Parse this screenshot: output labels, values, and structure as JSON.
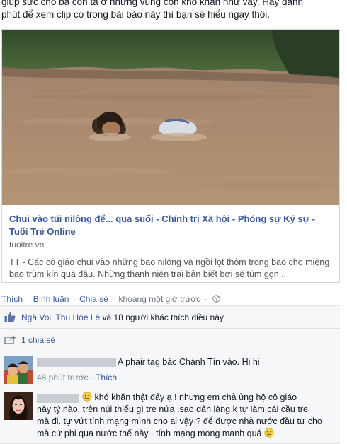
{
  "post": {
    "text_line1": "giúp sức cho bà con ta ở những vùng còn khó khăn như vậy. Hãy dành",
    "text_line2": "phút để xem clip có trong bài báo này thì bạn sẽ hiểu ngay thôi."
  },
  "link_card": {
    "title": "Chui vào túi nilông để... qua suối - Chính trị Xã hội - Phóng sự Ký sự - Tuổi Trẻ Online",
    "domain": "tuoitre.vn",
    "description": "TT - Các cô giáo chui vào những bao nilông và ngồi lọt thỏm trong bao cho miệng bao trùm kín quá đầu. Những thanh niên trai bản biết bơi sẽ túm gọn..."
  },
  "actions": {
    "like": "Thích",
    "comment": "Bình luận",
    "share": "Chia sẻ",
    "time": "khoảng một giờ trước",
    "separator": "·"
  },
  "likes": {
    "names": "Ngà Voi, Thu Hòe Lê",
    "rest": " và 18 người khác thích điều này."
  },
  "shares": {
    "text": "1 chia sẻ"
  },
  "comments": [
    {
      "text": "A phair tag bác Chánh Tín vào. Hi hi",
      "time": "48 phút trước",
      "like": "Thích",
      "separator": "·"
    },
    {
      "emoticon": "smile-emoticon",
      "line1": " khó khăn thật đấy ạ ! nhưng em chả ủng hộ cô giáo",
      "line2": "này tý nào. trên núi thiếu gì tre nứa .sao dân làng k tự làm cái cầu tre",
      "line3": "mà đi. tự vứt tính mạng mình cho ai vậy ? để được nhà nước đầu tư cho",
      "line4": "mà cứ phi qua nước thế này . tính mạng mong manh quá"
    }
  ],
  "colors": {
    "link_blue": "#3b5998",
    "muted": "#7f8793",
    "water": "#a88468"
  }
}
